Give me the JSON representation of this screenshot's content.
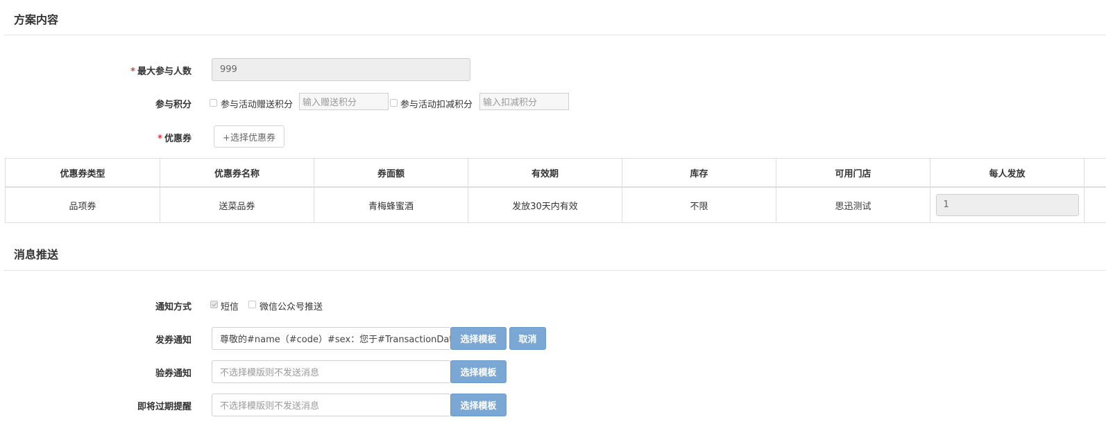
{
  "sections": {
    "plan": {
      "title": "方案内容"
    },
    "message": {
      "title": "消息推送"
    }
  },
  "plan": {
    "max_participants": {
      "label": "最大参与人数",
      "required": "*",
      "value": "999"
    },
    "points": {
      "label": "参与积分",
      "give": {
        "label": "参与活动赠送积分",
        "placeholder": "输入赠送积分"
      },
      "deduct": {
        "label": "参与活动扣减积分",
        "placeholder": "输入扣减积分"
      }
    },
    "coupon": {
      "label": "优惠券",
      "required": "*",
      "button": "+选择优惠券"
    }
  },
  "coupon_table": {
    "headers": [
      "优惠券类型",
      "优惠券名称",
      "券面额",
      "有效期",
      "库存",
      "可用门店",
      "每人发放"
    ],
    "rows": [
      {
        "type": "品项券",
        "name": "送菜品券",
        "value": "青梅蜂蜜酒",
        "validity": "发放30天内有效",
        "stock": "不限",
        "stores": "思迅测试",
        "per_person": "1"
      }
    ]
  },
  "message": {
    "notify_method": {
      "label": "通知方式",
      "sms": {
        "label": "短信",
        "checked": true
      },
      "wechat": {
        "label": "微信公众号推送",
        "checked": false
      }
    },
    "issue_notice": {
      "label": "发券通知",
      "value": "尊敬的#name（#code）#sex：您于#TransactionDat",
      "select_button": "选择模板",
      "cancel_button": "取消"
    },
    "verify_notice": {
      "label": "验券通知",
      "placeholder": "不选择模版则不发送消息",
      "select_button": "选择模板"
    },
    "expiry_notice": {
      "label": "即将过期提醒",
      "placeholder": "不选择模版则不发送消息",
      "select_button": "选择模板"
    }
  },
  "colors": {
    "primary_button": "#7ba7d4",
    "required": "#e4393c",
    "disabled_bg": "#eeeeee"
  }
}
